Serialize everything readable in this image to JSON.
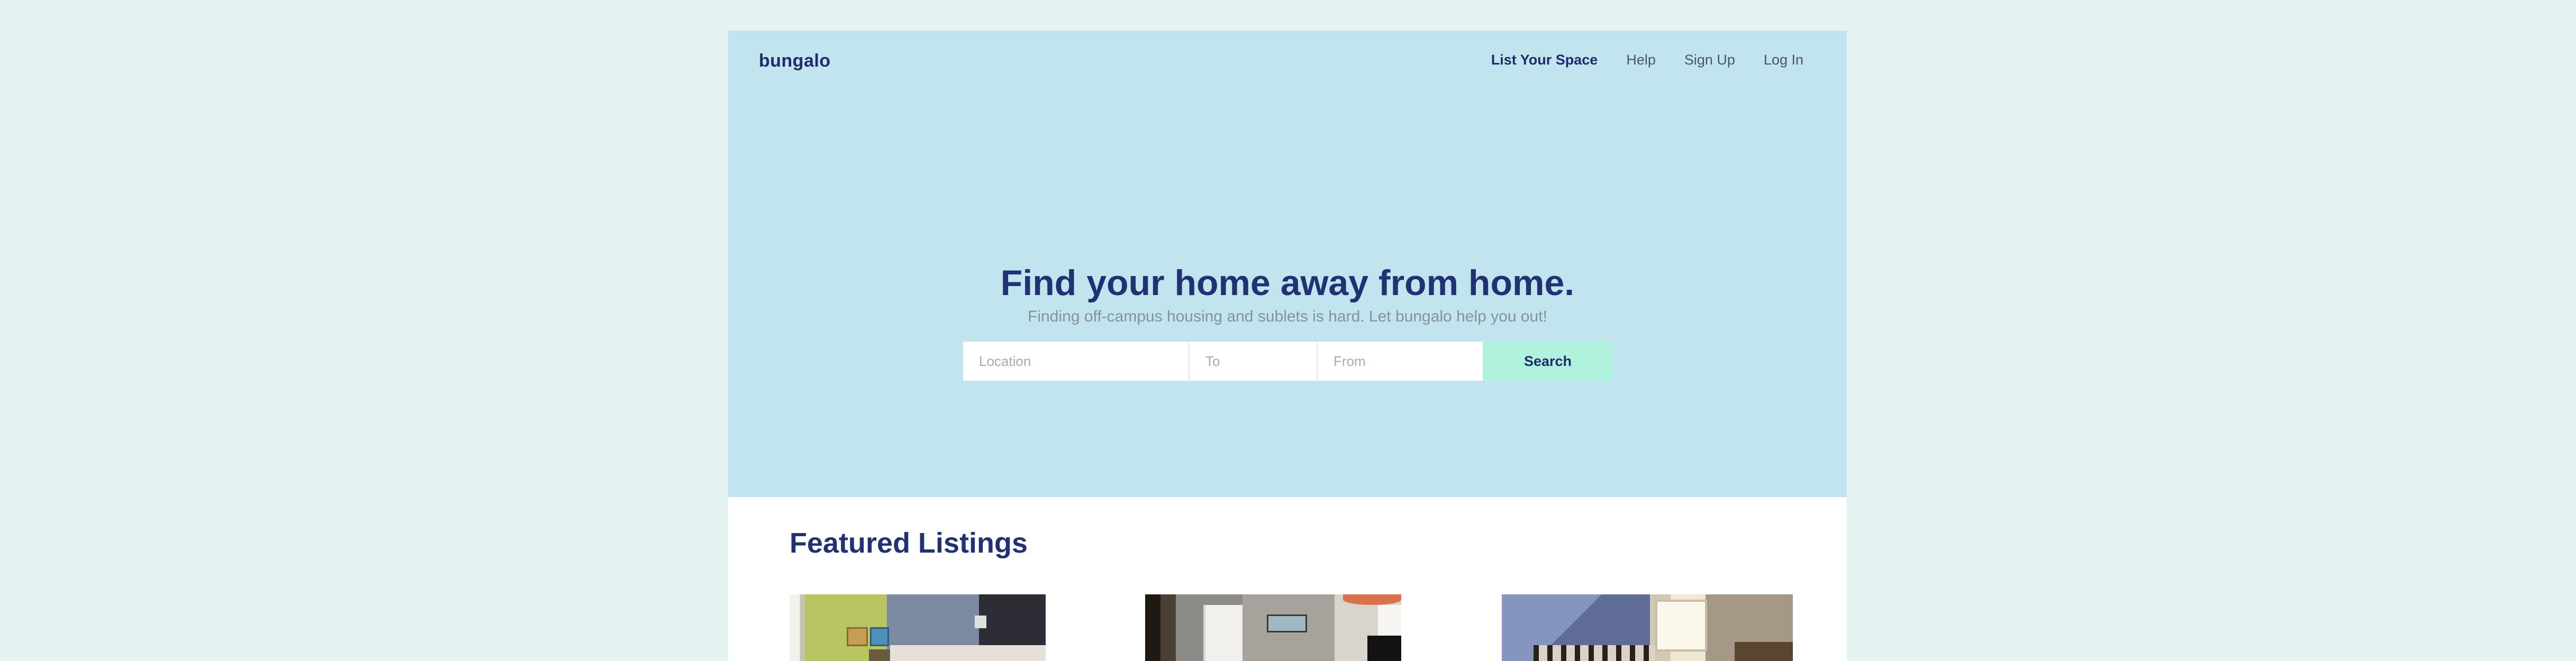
{
  "brand": {
    "name": "bungalo"
  },
  "nav": {
    "list_your_space": "List Your Space",
    "help": "Help",
    "sign_up": "Sign Up",
    "log_in": "Log In"
  },
  "hero": {
    "title": "Find your home away from home.",
    "subtitle": "Finding off-campus housing and sublets is hard. Let bungalo help you out!"
  },
  "search": {
    "location_placeholder": "Location",
    "to_placeholder": "To",
    "from_placeholder": "From",
    "button_label": "Search"
  },
  "featured": {
    "title": "Featured Listings",
    "listings": [
      {
        "image": "bedroom-photo"
      },
      {
        "image": "living-room-photo"
      },
      {
        "image": "attic-bedroom-photo"
      }
    ]
  },
  "colors": {
    "page_background": "#e5f3f3",
    "hero_background": "#c1e4ee",
    "brand_navy": "#223172",
    "search_button": "#b0f2de"
  }
}
